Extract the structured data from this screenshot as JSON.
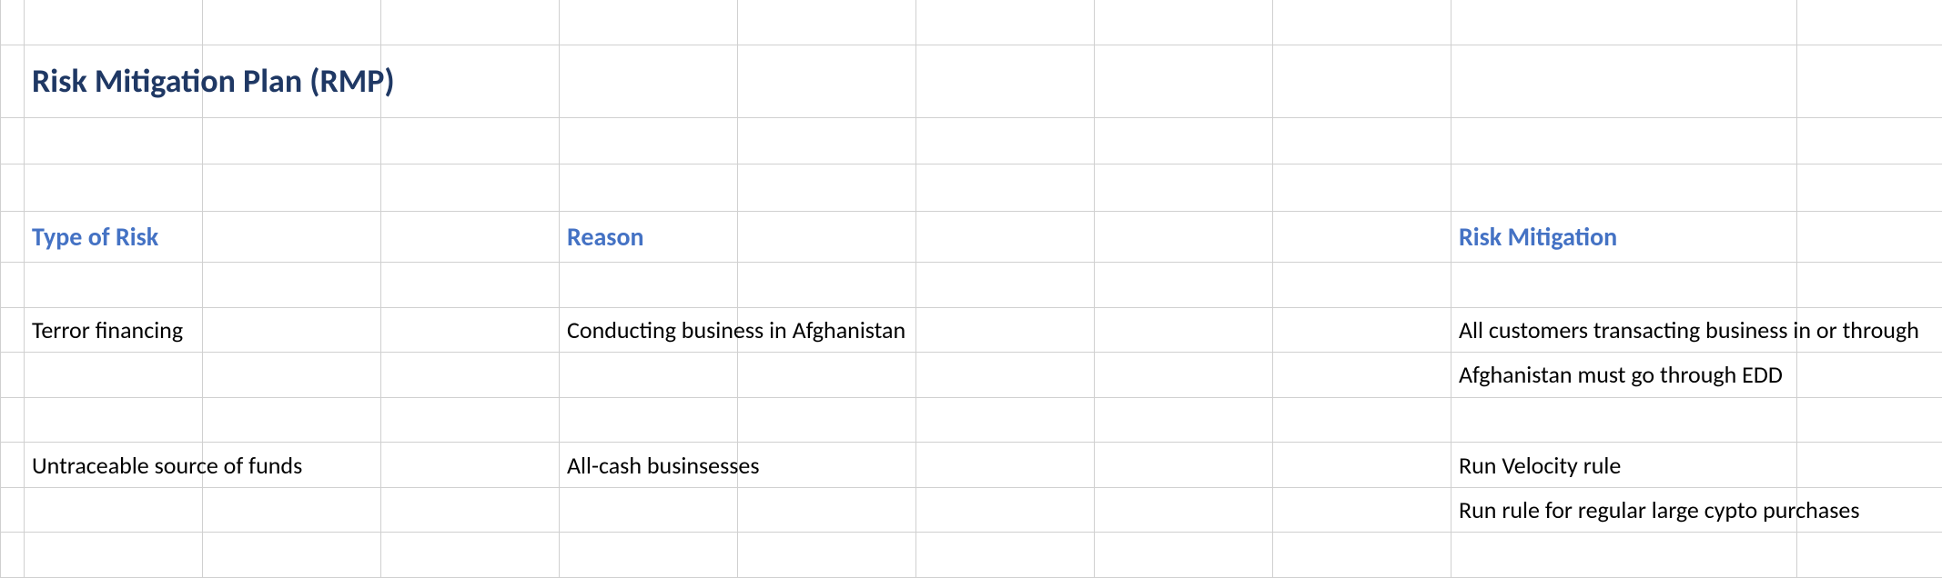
{
  "title": "Risk Mitigation Plan (RMP)",
  "columns": {
    "type": "Type of Risk",
    "reason": "Reason",
    "mitigation": "Risk Mitigation"
  },
  "rows": [
    {
      "type": "Terror financing",
      "reason": "Conducting business in Afghanistan",
      "mitigation_lines": [
        "All customers transacting business in or through",
        "Afghanistan must go through EDD"
      ]
    },
    {
      "type": "Untraceable source of funds",
      "reason": "All-cash businsesses",
      "mitigation_lines": [
        "Run Velocity rule",
        "Run rule for regular large cypto purchases"
      ]
    }
  ]
}
